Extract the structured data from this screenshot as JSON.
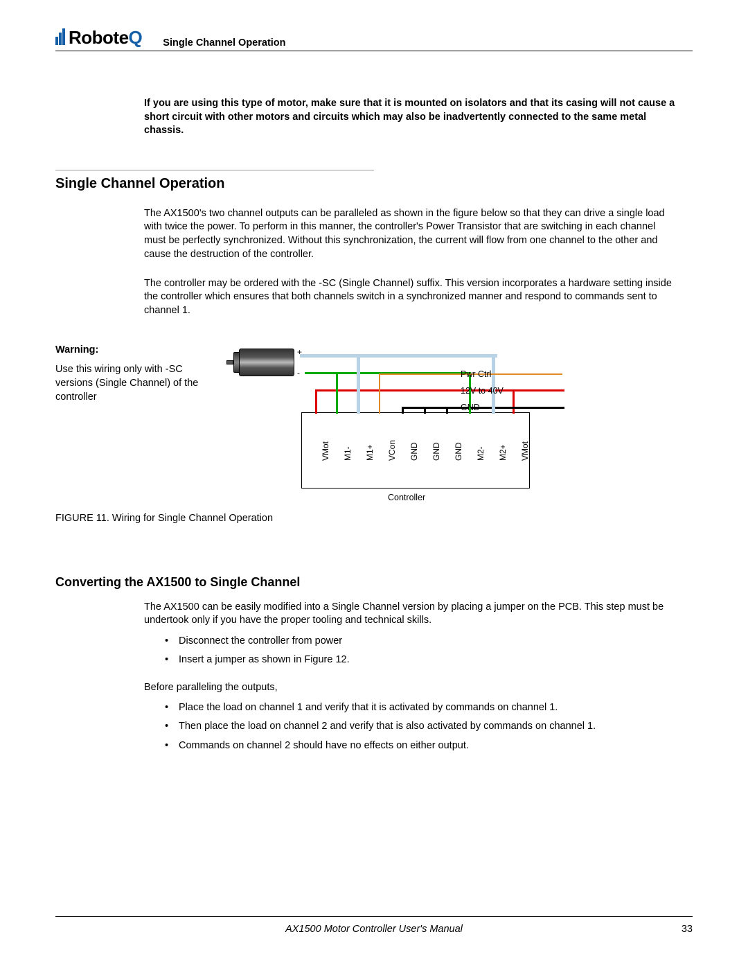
{
  "logo": {
    "name": "Robote",
    "accent": "Q"
  },
  "header_title": "Single Channel Operation",
  "intro_bold": "If you are using this type of motor, make sure that it is mounted on isolators and that its casing will not cause a short circuit with other motors and circuits which may also be inadvertently connected to the same metal chassis.",
  "section1": {
    "title": "Single Channel Operation",
    "p1": "The AX1500's two channel outputs can be paralleled as shown in the figure below so that they can drive a single load with twice the power. To perform in this manner, the controller's Power Transistor that are switching in each channel must be perfectly synchronized. Without this synchronization, the current will flow from one channel to the other and cause the destruction of the controller.",
    "p2": "The controller may be ordered with the -SC (Single Channel) suffix. This version incorporates a hardware setting inside the controller which ensures that both channels switch in a synchronized manner and respond to commands sent to channel 1."
  },
  "warning": {
    "label": "Warning:",
    "body": "Use this wiring only with -SC versions (Single Channel) of the controller"
  },
  "diagram": {
    "terminals": [
      "VMot",
      "M1-",
      "M1+",
      "VCon",
      "GND",
      "GND",
      "GND",
      "M2-",
      "M2+",
      "VMot"
    ],
    "side_labels": {
      "pwr": "Pwr Ctrl",
      "volt": "12V to 40V",
      "gnd": "GND"
    },
    "controller_label": "Controller",
    "motor_plus": "+",
    "motor_minus": "-",
    "caption": "FIGURE 11.  Wiring for Single Channel Operation"
  },
  "section2": {
    "title": "Converting the AX1500 to Single Channel",
    "p1": "The AX1500 can be easily modified into a Single Channel version by placing a jumper on the PCB. This step must be undertook only if you have the proper tooling and technical skills.",
    "list1": [
      "Disconnect the controller from power",
      "Insert a jumper as shown in Figure 12."
    ],
    "p2": "Before paralleling the outputs,",
    "list2": [
      "Place the load on channel 1 and verify that it is activated by commands on channel 1.",
      "Then place the load on channel 2 and verify that is also activated by commands on channel 1.",
      "Commands on channel 2 should have no effects on either output."
    ]
  },
  "footer": {
    "title": "AX1500 Motor Controller User's Manual",
    "page": "33"
  }
}
